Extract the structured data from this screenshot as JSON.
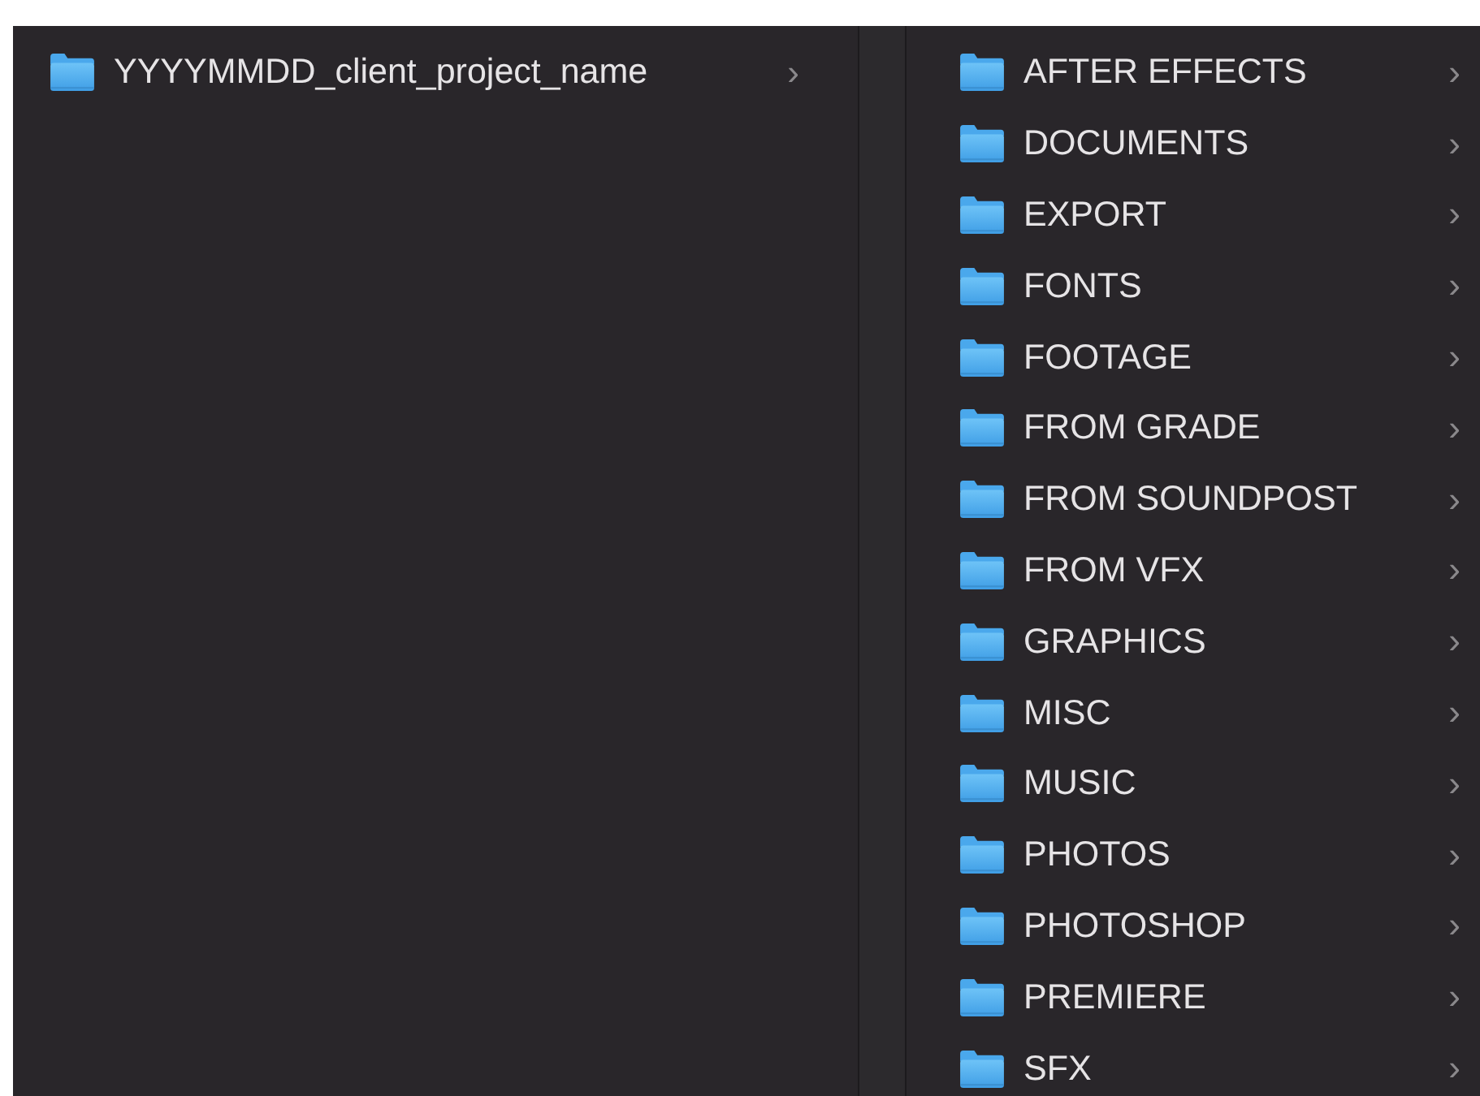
{
  "columns": [
    {
      "items": [
        {
          "label": "YYYYMMDD_client_project_name",
          "chevron": "›"
        }
      ]
    },
    {
      "items": [
        {
          "label": "AFTER EFFECTS",
          "chevron": "›"
        },
        {
          "label": "DOCUMENTS",
          "chevron": "›"
        },
        {
          "label": "EXPORT",
          "chevron": "›"
        },
        {
          "label": "FONTS",
          "chevron": "›"
        },
        {
          "label": "FOOTAGE",
          "chevron": "›"
        },
        {
          "label": "FROM GRADE",
          "chevron": "›"
        },
        {
          "label": "FROM SOUNDPOST",
          "chevron": "›"
        },
        {
          "label": "FROM VFX",
          "chevron": "›"
        },
        {
          "label": "GRAPHICS",
          "chevron": "›"
        },
        {
          "label": "MISC",
          "chevron": "›"
        },
        {
          "label": "MUSIC",
          "chevron": "›"
        },
        {
          "label": "PHOTOS",
          "chevron": "›"
        },
        {
          "label": "PHOTOSHOP",
          "chevron": "›"
        },
        {
          "label": "PREMIERE",
          "chevron": "›"
        },
        {
          "label": "SFX",
          "chevron": "›"
        }
      ]
    }
  ]
}
